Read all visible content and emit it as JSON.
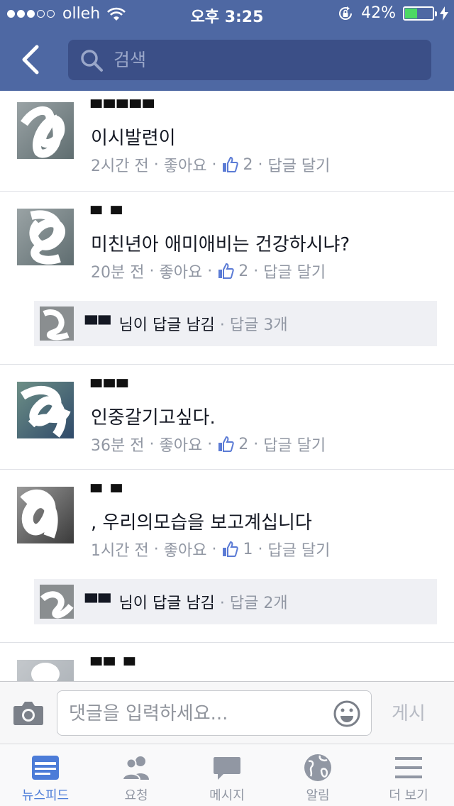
{
  "status_bar": {
    "carrier": "olleh",
    "time": "오후 3:25",
    "battery": "42%",
    "battery_level": 0.42,
    "signal_bars": 3,
    "signal_total": 5
  },
  "nav": {
    "search_placeholder": "검색"
  },
  "comments": [
    {
      "text": "이시발련이",
      "time": "2시간 전",
      "like_label": "좋아요",
      "likes": "2",
      "reply_label": "답글 달기"
    },
    {
      "text": "미친년아 애미애비는 건강하시냐?",
      "time": "20분 전",
      "like_label": "좋아요",
      "likes": "2",
      "reply_label": "답글 달기",
      "reply_summary": {
        "text": "님이 답글 남김",
        "count": "답글 3개"
      }
    },
    {
      "text": "인중갈기고싶다.",
      "time": "36분 전",
      "like_label": "좋아요",
      "likes": "2",
      "reply_label": "답글 달기"
    },
    {
      "text": ", 우리의모습을 보고계십니다",
      "time": "1시간 전",
      "like_label": "좋아요",
      "likes": "1",
      "reply_label": "답글 달기",
      "reply_summary": {
        "text": "님이 답글 남김",
        "count": "답글 2개"
      }
    }
  ],
  "composer": {
    "placeholder": "댓글을 입력하세요...",
    "post_label": "게시"
  },
  "tabs": [
    {
      "label": "뉴스피드",
      "icon": "newsfeed-icon",
      "active": true
    },
    {
      "label": "요청",
      "icon": "friend-requests-icon",
      "active": false
    },
    {
      "label": "메시지",
      "icon": "messages-icon",
      "active": false
    },
    {
      "label": "알림",
      "icon": "globe-icon",
      "active": false
    },
    {
      "label": "더 보기",
      "icon": "menu-icon",
      "active": false
    }
  ],
  "colors": {
    "nav_bar": "#4e68a3",
    "search_field": "#3b4f87",
    "like_blue": "#5b7bd5",
    "active_tab": "#4c7cd8",
    "meta_gray": "#9197a3",
    "battery_fill": "#4cd964"
  }
}
